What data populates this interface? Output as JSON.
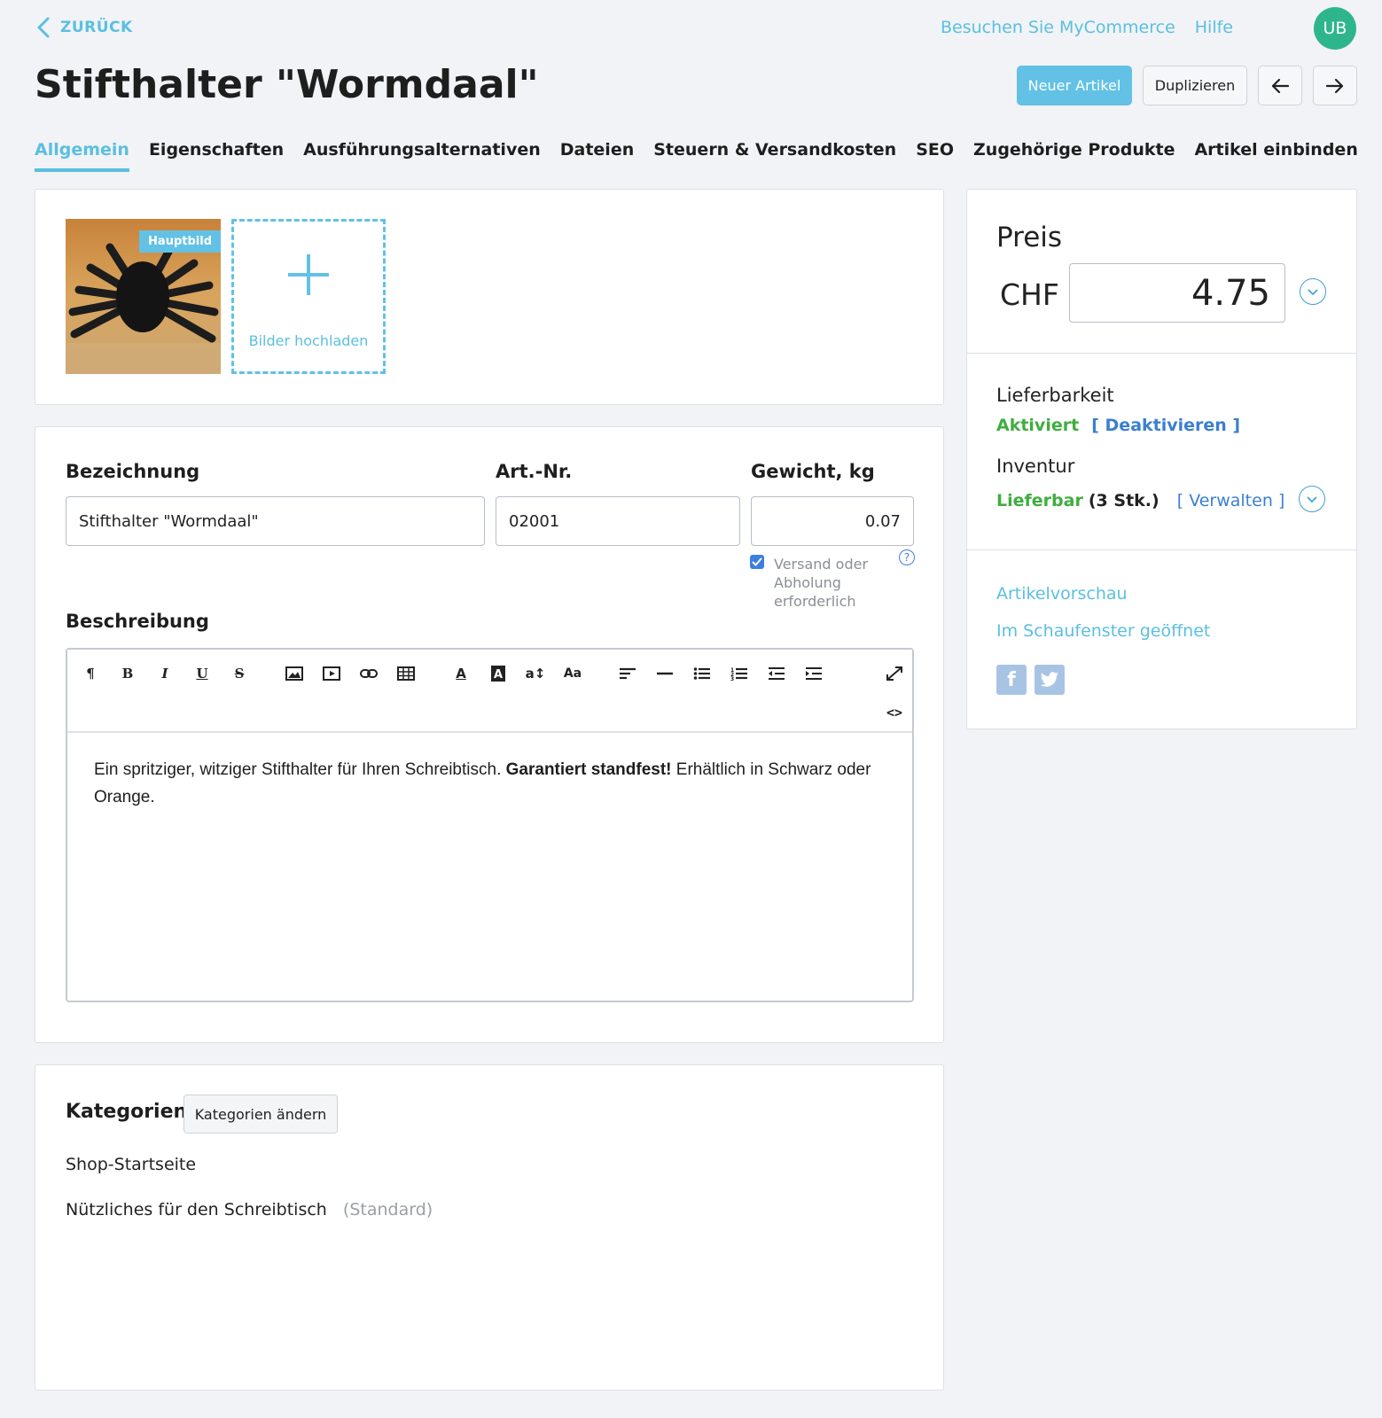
{
  "header": {
    "back_label": "ZURÜCK",
    "visit_link": "Besuchen Sie MyCommerce",
    "help_link": "Hilfe",
    "avatar_initials": "UB",
    "page_title": "Stifthalter \"Wormdaal\"",
    "new_article": "Neuer Artikel",
    "duplicate": "Duplizieren"
  },
  "tabs": [
    {
      "label": "Allgemein",
      "active": true
    },
    {
      "label": "Eigenschaften"
    },
    {
      "label": "Ausführungsalternativen"
    },
    {
      "label": "Dateien"
    },
    {
      "label": "Steuern & Versandkosten"
    },
    {
      "label": "SEO"
    },
    {
      "label": "Zugehörige Produkte"
    },
    {
      "label": "Artikel einbinden"
    }
  ],
  "images": {
    "main_badge": "Hauptbild",
    "upload_label": "Bilder hochladen"
  },
  "form": {
    "name_label": "Bezeichnung",
    "name_value": "Stifthalter \"Wormdaal\"",
    "sku_label": "Art.-Nr.",
    "sku_value": "02001",
    "weight_label": "Gewicht, kg",
    "weight_value": "0.07",
    "shipping_note": "Versand oder Abholung erforderlich",
    "shipping_checked": true,
    "description_label": "Beschreibung",
    "description_part1": "Ein spritziger, witziger Stifthalter für Ihren Schreibtisch. ",
    "description_bold": "Garantiert standfest!",
    "description_part2": " Erhältlich in Schwarz oder Orange."
  },
  "categories": {
    "title": "Kategorien",
    "change_button": "Kategorien ändern",
    "items": [
      {
        "name": "Shop-Startseite",
        "note": ""
      },
      {
        "name": "Nützliches für den Schreibtisch",
        "note": "(Standard)"
      }
    ]
  },
  "sidebar": {
    "price_title": "Preis",
    "currency": "CHF",
    "price_value": "4.75",
    "availability_label": "Lieferbarkeit",
    "availability_status": "Aktiviert",
    "availability_action": "[ Deaktivieren ]",
    "inventory_label": "Inventur",
    "inventory_status": "Lieferbar",
    "inventory_count": "(3 Stk.)",
    "inventory_action": "[ Verwalten ]",
    "preview_link": "Artikelvorschau",
    "storefront_link": "Im Schaufenster geöffnet"
  },
  "colors": {
    "accent": "#5bbfe0",
    "green": "#3fae3f",
    "avatar": "#2fb58c"
  }
}
